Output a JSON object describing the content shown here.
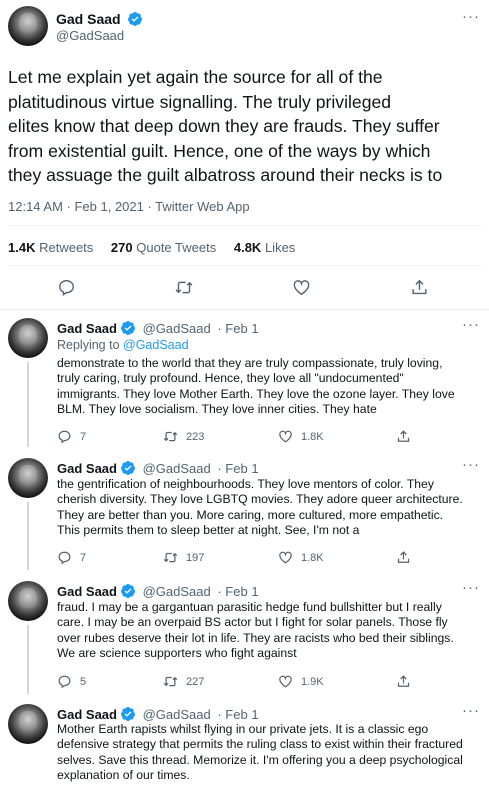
{
  "main_tweet": {
    "author_name": "Gad Saad",
    "handle": "@GadSaad",
    "text_lines": [
      "Let me explain yet again the source for all of the",
      "platitudinous virtue signalling.  The truly privileged",
      "elites know that deep down they are frauds.  They suffer",
      "from existential guilt. Hence, one of the ways by which",
      "they assuage the guilt albatross around their necks is to"
    ],
    "timestamp": "12:14 AM · Feb 1, 2021 · Twitter Web App",
    "retweets_count": "1.4K",
    "retweets_label": "Retweets",
    "quote_count": "270",
    "quote_label": "Quote Tweets",
    "likes_count": "4.8K",
    "likes_label": "Likes"
  },
  "replies": [
    {
      "author_name": "Gad Saad",
      "handle": "@GadSaad",
      "date": "· Feb 1",
      "replying_prefix": "Replying to ",
      "replying_handle": "@GadSaad",
      "text_lines": [
        "demonstrate to the world that they are truly compassionate, truly loving,",
        "truly caring, truly profound. Hence, they love all \"undocumented\"",
        "immigrants.  They love Mother Earth. They love the ozone layer. They love",
        "BLM. They love socialism. They love inner cities. They hate"
      ],
      "reply_count": "7",
      "retweet_count": "223",
      "like_count": "1.8K"
    },
    {
      "author_name": "Gad Saad",
      "handle": "@GadSaad",
      "date": "· Feb 1",
      "text_lines": [
        "the gentrification of neighbourhoods.  They love mentors of color.  They",
        "cherish diversity. They love LGBTQ movies. They adore queer architecture.",
        "They are better than you. More caring, more cultured, more empathetic.",
        "This permits them to sleep better at night. See, I'm not a"
      ],
      "reply_count": "7",
      "retweet_count": "197",
      "like_count": "1.8K"
    },
    {
      "author_name": "Gad Saad",
      "handle": "@GadSaad",
      "date": "· Feb 1",
      "text_lines": [
        "fraud.  I may be a gargantuan parasitic hedge fund bullshitter but I really",
        "care. I may be an overpaid BS actor but I fight for solar panels.  Those fly",
        "over rubes deserve their lot in life.  They are racists who bed their siblings.",
        "We are science supporters who fight against"
      ],
      "reply_count": "5",
      "retweet_count": "227",
      "like_count": "1.9K"
    },
    {
      "author_name": "Gad Saad",
      "handle": "@GadSaad",
      "date": "· Feb 1",
      "text_lines": [
        "Mother Earth rapists whilst flying in our private jets. It is a classic ego",
        "defensive strategy that permits the ruling class to exist within their fractured",
        "selves.  Save this thread. Memorize it. I'm offering you a deep psychological",
        "explanation of our times."
      ]
    }
  ],
  "icons": {
    "verified_color": "#1d9bf0",
    "action_color": "#536471",
    "reply_icon": "speech-bubble",
    "retweet_icon": "two-arrows-loop",
    "like_icon": "heart-outline",
    "share_icon": "upload-arrow",
    "more_icon": "three-dots"
  },
  "more_glyph": "···"
}
